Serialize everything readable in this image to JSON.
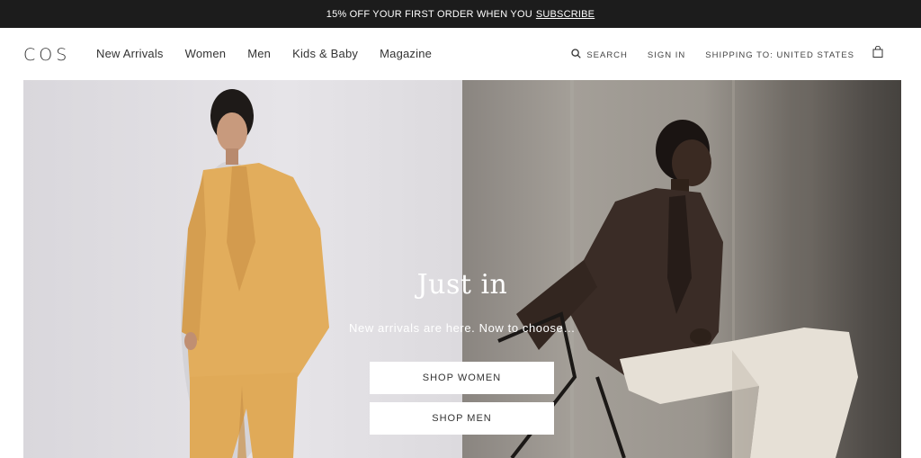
{
  "promo": {
    "text": "15% OFF YOUR FIRST ORDER WHEN YOU",
    "link": "SUBSCRIBE"
  },
  "header": {
    "logo": "COS",
    "nav": [
      "New Arrivals",
      "Women",
      "Men",
      "Kids & Baby",
      "Magazine"
    ],
    "search_label": "SEARCH",
    "signin_label": "SIGN IN",
    "shipping_label": "SHIPPING TO: UNITED STATES",
    "icons": {
      "search": "search-icon",
      "bag": "shopping-bag-icon"
    }
  },
  "hero": {
    "title": "Just in",
    "subtitle": "New arrivals are here. Now to choose…",
    "shop_women_label": "SHOP WOMEN",
    "shop_men_label": "SHOP MEN"
  },
  "colors": {
    "promo_bg": "#1c1c1c",
    "blazer": "#e2ad5c",
    "jacket": "#3a2c26",
    "trousers": "#e6e0d6"
  }
}
